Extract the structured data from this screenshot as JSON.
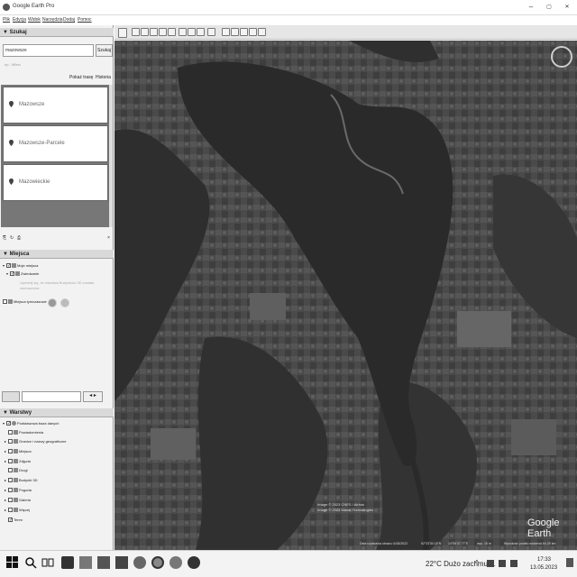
{
  "window": {
    "title": "Google Earth Pro",
    "minimize": "–",
    "maximize": "▢",
    "close": "✕"
  },
  "menu": [
    "Plik",
    "Edycja",
    "Widok",
    "Narzędzia",
    "Dodaj",
    "Pomoc"
  ],
  "search": {
    "header": "▼ Szukaj",
    "value": "mazowsze",
    "button": "Szukaj",
    "hint": "np., Wilno",
    "route_link": "Pokaż trasę",
    "history_link": "Historia",
    "results": [
      "Mazowsze",
      "Mazowsze-Parcele",
      "Mazowieckie"
    ]
  },
  "places": {
    "header": "▼ Miejsca",
    "items": [
      {
        "label": "Moje miejsca",
        "checked": true
      },
      {
        "label": "Zwiedzanie",
        "checked": true
      },
      {
        "label": "Upewnij się, że warstwa Budynków 3D została zaznaczona",
        "checked": false
      },
      {
        "label": "Miejsca tymczasowe",
        "checked": false
      }
    ]
  },
  "layers": {
    "header": "▼ Warstwy",
    "items": [
      {
        "label": "Podstawowa baza danych",
        "checked": true
      },
      {
        "label": "Powiadomienia",
        "checked": false
      },
      {
        "label": "Granice i nazwy geograficzne",
        "checked": false
      },
      {
        "label": "Miejsca",
        "checked": false
      },
      {
        "label": "Zdjęcia",
        "checked": false
      },
      {
        "label": "Drogi",
        "checked": false
      },
      {
        "label": "Budynki 3D",
        "checked": false
      },
      {
        "label": "Pogoda",
        "checked": false
      },
      {
        "label": "Galeria",
        "checked": false
      },
      {
        "label": "Więcej",
        "checked": false
      },
      {
        "label": "Teren",
        "checked": true
      }
    ]
  },
  "map": {
    "copyright": [
      "Image © 2023 CNES / Airbus",
      "Image © 2023 Maxar Technologies"
    ],
    "logo": "Google Earth",
    "status": {
      "imagery_date": "Data uzyskania obrazu: 6/18/2022",
      "lat": "52°33'30.18\"N",
      "lon": "14°55'37.77\"E",
      "elev": "wys.  15 m",
      "eye_alt": "Wysokość punktu widzenia  64.29 km"
    }
  },
  "taskbar": {
    "weather": "22°C  Dużo zachmur...",
    "time": "17:33",
    "date": "13.05.2023",
    "tray_arrow": "^"
  },
  "colors": {
    "map_dark": "#3d3d3d",
    "water": "#2a2a2a",
    "sidebar_bg": "#f2f2f2"
  }
}
